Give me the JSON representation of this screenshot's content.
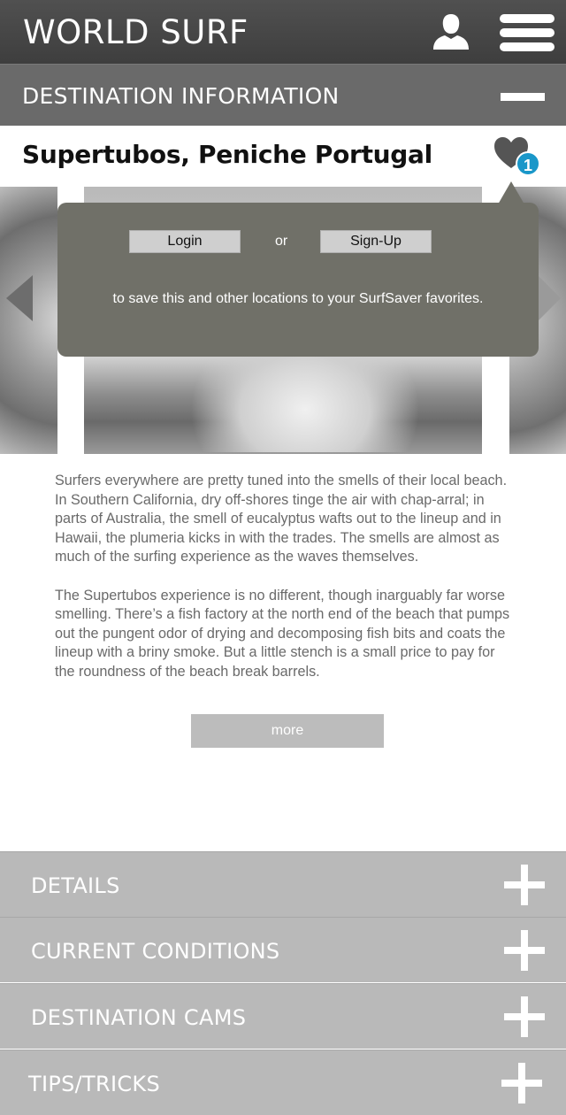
{
  "header": {
    "title": "WORLD SURF"
  },
  "section": {
    "title": "DESTINATION INFORMATION"
  },
  "destination": {
    "title": "Supertubos, Peniche Portugal",
    "favorites_count": "1"
  },
  "popup": {
    "login_label": "Login",
    "or_label": "or",
    "signup_label": "Sign-Up",
    "message": "to save this and other locations to your SurfSaver favorites."
  },
  "description": {
    "paragraphs": [
      "Surfers everywhere are pretty tuned into the smells of their local beach. In Southern California, dry off-shores tinge the air with chap-arral; in parts of Australia, the smell of eucalyptus wafts out to the lineup and in Hawaii, the plumeria kicks in with the trades. The smells are almost as much of the surfing experience as the waves themselves.",
      "The Supertubos experience is no different, though inarguably far worse smelling. There’s a fish factory at the north end of the beach that pumps out the pungent odor of drying and decomposing fish bits and coats the lineup with a briny smoke. But a little stench is a small price to pay for the roundness of the beach break barrels."
    ],
    "more_label": "more"
  },
  "accordion": [
    {
      "label": "DETAILS"
    },
    {
      "label": "CURRENT CONDITIONS"
    },
    {
      "label": "DESTINATION CAMS"
    },
    {
      "label": "TIPS/TRICKS"
    }
  ],
  "colors": {
    "badge": "#1a97c9",
    "topbar": "#464646",
    "sectionbar": "#6a6a6a",
    "accordion": "#b9b9b9",
    "popup": "#707068"
  },
  "icons": [
    "user-icon",
    "menu-icon",
    "collapse-icon",
    "heart-icon",
    "arrow-left-icon",
    "arrow-right-icon",
    "plus-icon"
  ]
}
